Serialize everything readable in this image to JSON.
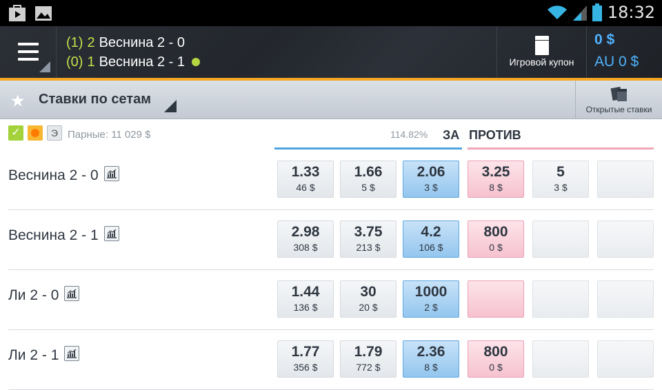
{
  "status_bar": {
    "time": "18:32",
    "icons": [
      "play-store-icon",
      "gallery-icon",
      "wifi-icon",
      "signal-icon",
      "battery-icon"
    ]
  },
  "header": {
    "score_lines": [
      {
        "sets": "(1)",
        "games": "2",
        "name": "Веснина 2 - 0"
      },
      {
        "sets": "(0)",
        "games": "1",
        "name": "Веснина 2 - 1"
      }
    ],
    "coupon_label": "Игровой купон",
    "balance_main": "0 $",
    "balance_au": "AU 0 $"
  },
  "section": {
    "title": "Ставки по сетам",
    "open_bets_label": "Открытые ставки"
  },
  "filters": {
    "e_label": "Э",
    "pair_label": "Парные: 11 029 $",
    "percent": "114.82%",
    "back_header": "ЗА",
    "lay_header": "ПРОТИВ"
  },
  "runners": [
    {
      "name": "Веснина 2 - 0",
      "back": [
        {
          "odd": "1.33",
          "amt": "46 $"
        },
        {
          "odd": "1.66",
          "amt": "5 $"
        },
        {
          "odd": "2.06",
          "amt": "3 $"
        }
      ],
      "lay": [
        {
          "odd": "3.25",
          "amt": "8 $"
        },
        {
          "odd": "5",
          "amt": "3 $"
        },
        {
          "odd": "",
          "amt": ""
        }
      ]
    },
    {
      "name": "Веснина 2 - 1",
      "back": [
        {
          "odd": "2.98",
          "amt": "308 $"
        },
        {
          "odd": "3.75",
          "amt": "213 $"
        },
        {
          "odd": "4.2",
          "amt": "106 $"
        }
      ],
      "lay": [
        {
          "odd": "800",
          "amt": "0 $"
        },
        {
          "odd": "",
          "amt": ""
        },
        {
          "odd": "",
          "amt": ""
        }
      ]
    },
    {
      "name": "Ли 2 - 0",
      "back": [
        {
          "odd": "1.44",
          "amt": "136 $"
        },
        {
          "odd": "30",
          "amt": "20 $"
        },
        {
          "odd": "1000",
          "amt": "2 $"
        }
      ],
      "lay": [
        {
          "odd": "",
          "amt": ""
        },
        {
          "odd": "",
          "amt": ""
        },
        {
          "odd": "",
          "amt": ""
        }
      ]
    },
    {
      "name": "Ли 2 - 1",
      "back": [
        {
          "odd": "1.77",
          "amt": "356 $"
        },
        {
          "odd": "1.79",
          "amt": "772 $"
        },
        {
          "odd": "2.36",
          "amt": "8 $"
        }
      ],
      "lay": [
        {
          "odd": "800",
          "amt": "0 $"
        },
        {
          "odd": "",
          "amt": ""
        },
        {
          "odd": "",
          "amt": ""
        }
      ]
    }
  ],
  "colors": {
    "accent_orange": "#f5a623",
    "back_blue": "#94c6ee",
    "lay_pink": "#f6c2cf",
    "balance_blue": "#4fb3ff",
    "serve_green": "#b6d641"
  }
}
